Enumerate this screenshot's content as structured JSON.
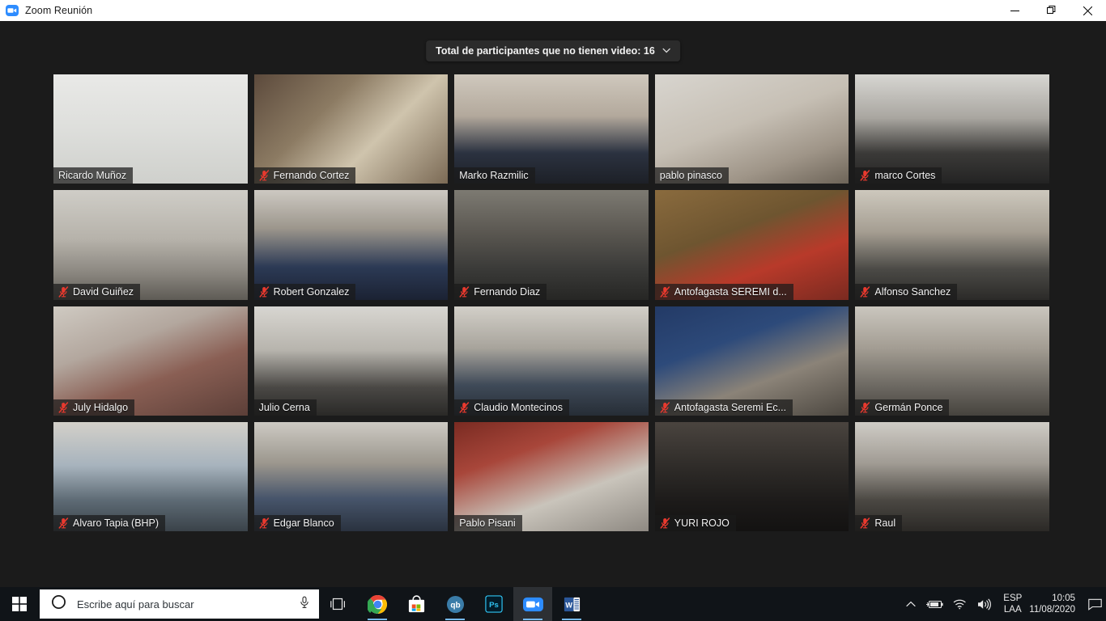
{
  "window": {
    "title": "Zoom Reunión",
    "app_icon": "zoom-video-icon",
    "minimize_label": "─",
    "restore_label": "restore-icon",
    "close_label": "✕"
  },
  "banner": {
    "text": "Total de participantes que no tienen video: 16",
    "chevron": "˅"
  },
  "grid": {
    "columns": 5,
    "rows": 4,
    "active_border_color": "#d4e83a",
    "mute_icon_color": "#e8392e",
    "participants": [
      {
        "name": "Ricardo Muñoz",
        "muted": false,
        "active": true,
        "bg": "linear-gradient(180deg,#e9e9e7 0%,#dedfdc 48%,#cfd0cc 100%)"
      },
      {
        "name": "Fernando Cortez",
        "muted": true,
        "active": false,
        "bg": "linear-gradient(135deg,#5c4a3c 0%,#8c7b63 35%,#cfc4ad 62%,#7b6a55 100%)"
      },
      {
        "name": "Marko Razmilic",
        "muted": false,
        "active": false,
        "bg": "linear-gradient(180deg,#cfc8bd 0%,#b3a99c 38%,#2b3240 72%,#1d2027 100%)"
      },
      {
        "name": "pablo pinasco",
        "muted": false,
        "active": false,
        "bg": "linear-gradient(160deg,#d8d5cf 0%,#c6bfb4 45%,#9f9588 75%,#6d6458 100%)"
      },
      {
        "name": "marco Cortes",
        "muted": true,
        "active": false,
        "bg": "linear-gradient(180deg,#d7d6d2 0%,#a9a6a0 40%,#3b3a38 72%,#232323 100%)"
      },
      {
        "name": "David Guiñez",
        "muted": true,
        "active": false,
        "bg": "linear-gradient(180deg,#cfcdc7 0%,#b6b2aa 45%,#8b8780 75%,#5e5b55 100%)"
      },
      {
        "name": "Robert Gonzalez",
        "muted": true,
        "active": false,
        "bg": "linear-gradient(180deg,#cdc9c2 0%,#9c968c 35%,#2c3a55 70%,#1b2233 100%)"
      },
      {
        "name": "Fernando Diaz",
        "muted": true,
        "active": false,
        "bg": "linear-gradient(180deg,#7d7a72 0%,#595650 40%,#3a3a38 72%,#262624 100%)"
      },
      {
        "name": "Antofagasta SEREMI d...",
        "muted": true,
        "active": false,
        "bg": "linear-gradient(160deg,#8a6b3e 0%,#6e5530 38%,#b83a2a 66%,#7a2a20 100%)"
      },
      {
        "name": "Alfonso Sanchez",
        "muted": true,
        "active": false,
        "bg": "linear-gradient(180deg,#cdc8bd 0%,#a59e92 38%,#4b4a46 72%,#2b2a28 100%)"
      },
      {
        "name": "July Hidalgo",
        "muted": true,
        "active": false,
        "bg": "linear-gradient(160deg,#cfcac2 0%,#b3a79e 34%,#8a5f54 62%,#5c3f38 100%)"
      },
      {
        "name": "Julio Cerna",
        "muted": false,
        "active": false,
        "bg": "linear-gradient(180deg,#d8d6d1 0%,#b7b4ad 40%,#4a4845 74%,#2a2927 100%)"
      },
      {
        "name": "Claudio Montecinos",
        "muted": true,
        "active": false,
        "bg": "linear-gradient(180deg,#d2cfc8 0%,#a8a49c 38%,#3f4a58 72%,#262d36 100%)"
      },
      {
        "name": "Antofagasta Seremi Ec...",
        "muted": true,
        "active": false,
        "bg": "linear-gradient(160deg,#233a66 0%,#2d4a7a 34%,#8b8378 64%,#4c4740 100%)"
      },
      {
        "name": "Germán Ponce",
        "muted": true,
        "active": false,
        "bg": "linear-gradient(180deg,#cac6be 0%,#a39d93 38%,#6e6a63 72%,#46433e 100%)"
      },
      {
        "name": "Alvaro Tapia (BHP)",
        "muted": true,
        "active": false,
        "bg": "linear-gradient(180deg,#d3d0c9 0%,#a7b3bd 40%,#5d6a74 72%,#3a4249 100%)"
      },
      {
        "name": "Edgar Blanco",
        "muted": true,
        "active": false,
        "bg": "linear-gradient(180deg,#cdcac3 0%,#9b968d 38%,#47556b 70%,#2a323f 100%)"
      },
      {
        "name": "Pablo Pisani",
        "muted": false,
        "active": false,
        "bg": "linear-gradient(160deg,#7a2b22 0%,#a8463a 30%,#c9c4bb 64%,#8e8982 100%)"
      },
      {
        "name": "YURI ROJO",
        "muted": true,
        "active": false,
        "bg": "linear-gradient(180deg,#4a443f 0%,#2e2b28 42%,#1c1a19 74%,#131211 100%)"
      },
      {
        "name": "Raul",
        "muted": true,
        "active": false,
        "bg": "linear-gradient(180deg,#cfccc6 0%,#a09b93 38%,#4a4742 72%,#2b2926 100%)"
      }
    ]
  },
  "taskbar": {
    "start_label": "start-button",
    "search_placeholder": "Escribe aquí para buscar",
    "icons": [
      {
        "name": "task-view-icon",
        "label": "Task View"
      },
      {
        "name": "google-chrome-icon",
        "label": "Google Chrome"
      },
      {
        "name": "microsoft-store-icon",
        "label": "Microsoft Store"
      },
      {
        "name": "qbittorrent-icon",
        "label": "qb"
      },
      {
        "name": "photoshop-icon",
        "label": "Ps"
      },
      {
        "name": "zoom-icon",
        "label": "Zoom"
      },
      {
        "name": "word-icon",
        "label": "W"
      }
    ],
    "tray": {
      "show_hidden": "⌃",
      "language_line1": "ESP",
      "language_line2": "LAA",
      "time": "10:05",
      "date": "11/08/2020"
    }
  }
}
